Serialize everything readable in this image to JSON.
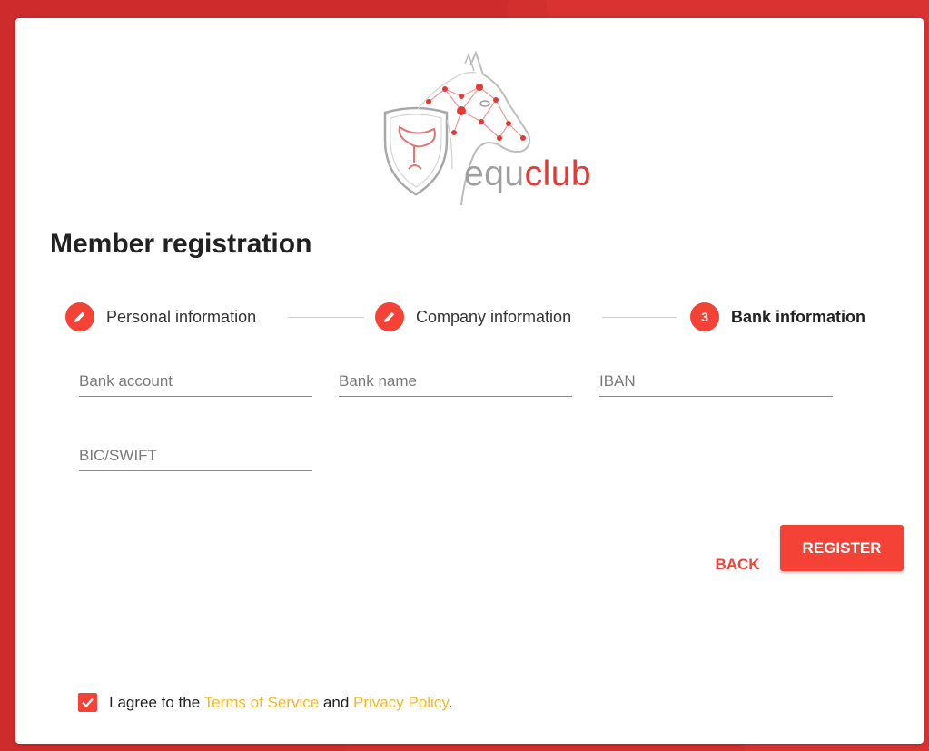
{
  "brand": {
    "name_part1": "equ",
    "name_part2": "club",
    "accent_color": "#f44336",
    "logo_icon": "horse-shield-saddle-logo"
  },
  "page": {
    "title": "Member registration"
  },
  "stepper": {
    "steps": [
      {
        "label": "Personal information",
        "state": "completed",
        "icon": "pencil-icon"
      },
      {
        "label": "Company information",
        "state": "completed",
        "icon": "pencil-icon"
      },
      {
        "label": "Bank information",
        "state": "active",
        "number": "3"
      }
    ]
  },
  "form": {
    "bank_account": {
      "placeholder": "Bank account",
      "value": ""
    },
    "bank_name": {
      "placeholder": "Bank name",
      "value": ""
    },
    "iban": {
      "placeholder": "IBAN",
      "value": ""
    },
    "bic_swift": {
      "placeholder": "BIC/SWIFT",
      "value": ""
    }
  },
  "actions": {
    "back_label": "BACK",
    "register_label": "REGISTER"
  },
  "agreement": {
    "checked": true,
    "prefix": "I agree to the ",
    "terms_label": "Terms of Service",
    "middle": " and ",
    "privacy_label": "Privacy Policy",
    "suffix": ".",
    "link_color": "#f5b921"
  }
}
